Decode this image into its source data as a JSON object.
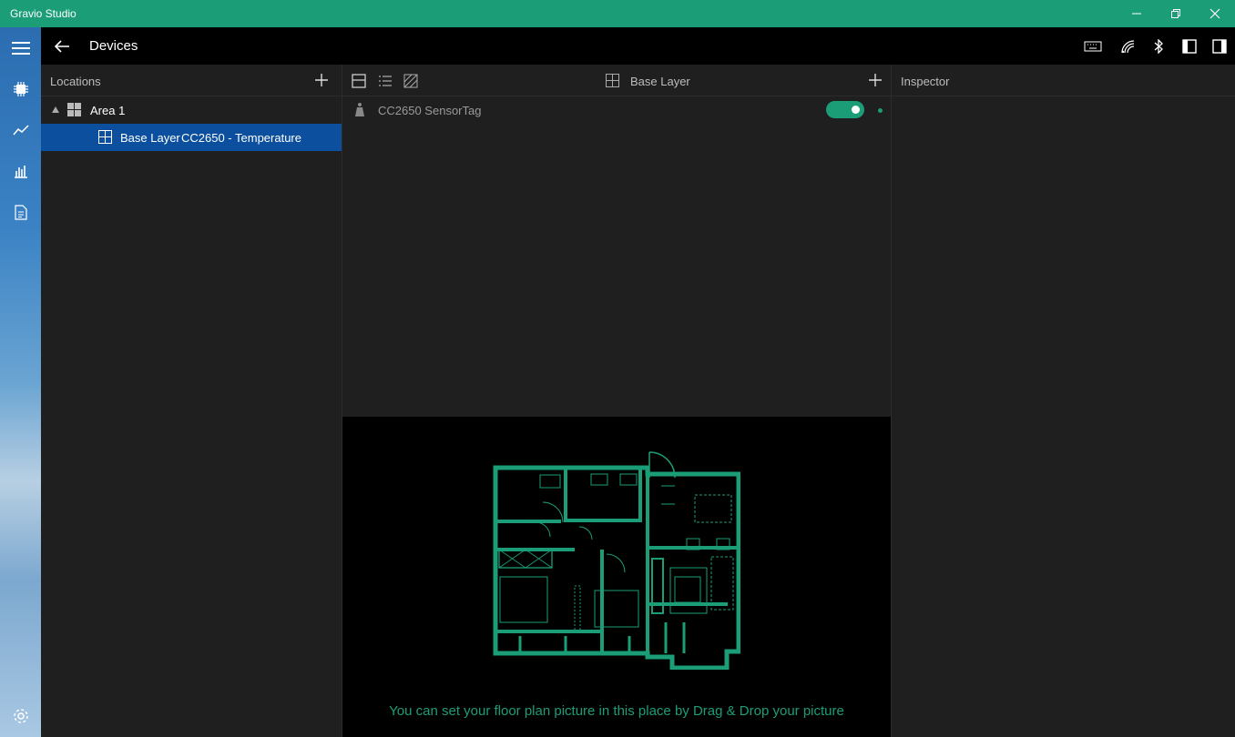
{
  "window": {
    "title": "Gravio Studio"
  },
  "header": {
    "title": "Devices"
  },
  "locations": {
    "title": "Locations",
    "tree": [
      {
        "label": "Area 1"
      },
      {
        "label": "Base Layer",
        "detail": "CC2650 - Temperature"
      }
    ]
  },
  "devices": {
    "layer_label": "Base Layer",
    "items": [
      {
        "name": "CC2650 SensorTag",
        "enabled": true
      }
    ]
  },
  "floorplan": {
    "hint": "You can set your floor plan picture in this place by Drag & Drop your picture"
  },
  "inspector": {
    "title": "Inspector"
  },
  "colors": {
    "accent": "#1b9e78",
    "selection": "#0b4f9e",
    "panel": "#1f1f1f"
  },
  "icons": [
    "hamburger-icon",
    "devices-chip-icon",
    "line-chart-icon",
    "bar-chart-icon",
    "report-icon",
    "settings-gear-icon",
    "back-arrow-icon",
    "keyboard-icon",
    "wireless-icon",
    "bluetooth-icon",
    "left-panel-icon",
    "right-panel-icon",
    "add-icon",
    "layout-view-icon",
    "list-view-icon",
    "image-view-icon",
    "grid-icon",
    "sensor-icon"
  ]
}
